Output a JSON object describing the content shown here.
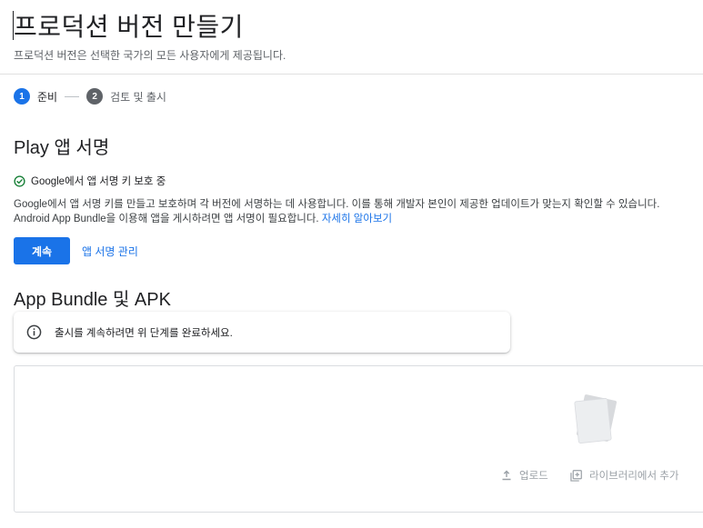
{
  "page": {
    "title": "프로덕션 버전 만들기",
    "subtitle": "프로덕션 버전은 선택한 국가의 모든 사용자에게 제공됩니다."
  },
  "stepper": {
    "steps": [
      {
        "number": "1",
        "label": "준비",
        "state": "active"
      },
      {
        "number": "2",
        "label": "검토 및 출시",
        "state": "inactive"
      }
    ]
  },
  "play_signing": {
    "title": "Play 앱 서명",
    "status_icon": "check-circle-icon",
    "status_text": "Google에서 앱 서명 키 보호 중",
    "description": "Google에서 앱 서명 키를 만들고 보호하며 각 버전에 서명하는 데 사용합니다. 이를 통해 개발자 본인이 제공한 업데이트가 맞는지 확인할 수 있습니다. Android App Bundle을 이용해 앱을 게시하려면 앱 서명이 필요합니다.",
    "learn_more": "자세히 알아보기",
    "continue_button": "계속",
    "manage_link": "앱 서명 관리"
  },
  "bundle": {
    "title": "App Bundle 및 APK",
    "info_icon": "info-icon",
    "info_text": "출시를 계속하려면 위 단계를 완료하세요.",
    "upload_icon": "upload-icon",
    "upload_label": "업로드",
    "library_icon": "library-add-icon",
    "library_label": "라이브러리에서 추가"
  },
  "colors": {
    "accent": "#1a73e8",
    "success": "#188038",
    "muted": "#9aa0a6"
  }
}
